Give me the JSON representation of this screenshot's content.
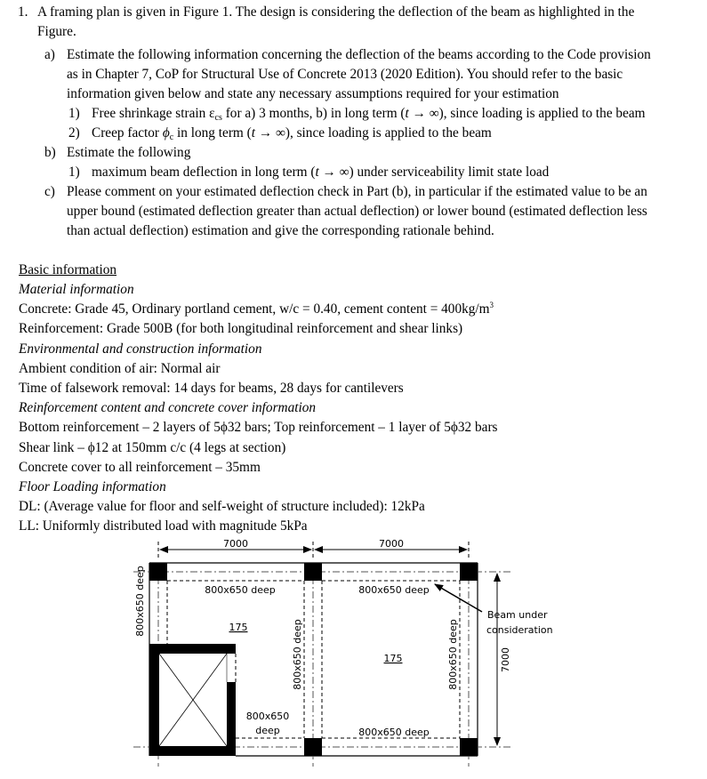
{
  "question": {
    "number": "1.",
    "intro_line1": "A framing plan is given in Figure 1. The design is considering the deflection of the beam as highlighted in the",
    "intro_line2": "Figure.",
    "part_a": {
      "label": "a)",
      "line1": "Estimate the following information concerning the deflection of the beams according to the Code provision",
      "line2": "as in Chapter 7, CoP for Structural Use of Concrete 2013 (2020 Edition). You should refer to the basic",
      "line3": "information given below and state any necessary assumptions required for your estimation",
      "items": [
        {
          "num": "1)",
          "pre": "Free shrinkage strain ",
          "sym": "ε",
          "sub": "cs",
          "post": " for a) 3 months, b) in long term (",
          "t": "t",
          "arrow": " → ∞), since loading is applied to the beam"
        },
        {
          "num": "2)",
          "pre": "Creep factor ",
          "sym": "ϕ",
          "sub": "c",
          "post": " in long term (",
          "t": "t",
          "arrow": " → ∞), since loading is applied to the beam"
        }
      ]
    },
    "part_b": {
      "label": "b)",
      "line1": "Estimate the following",
      "items": [
        {
          "num": "1)",
          "pre": "maximum beam deflection in long term (",
          "t": "t",
          "post": " → ∞) under serviceability limit state load"
        }
      ]
    },
    "part_c": {
      "label": "c)",
      "line1": "Please comment on your estimated deflection check in Part (b), in particular if the estimated value to be an",
      "line2": "upper bound (estimated deflection greater than actual deflection) or lower bound (estimated deflection less",
      "line3": "than actual deflection) estimation and give the corresponding rationale behind."
    }
  },
  "basic_info": {
    "heading": "Basic information",
    "material_heading": "Material information",
    "concrete": "Concrete: Grade 45, Ordinary portland cement, w/c = 0.40, cement content = 400kg/m",
    "concrete_sup": "3",
    "reinforcement": "Reinforcement: Grade 500B (for both longitudinal reinforcement and shear links)",
    "env_heading": "Environmental and construction information",
    "ambient": "Ambient condition of air: Normal air",
    "falsework": "Time of falsework removal: 14 days for beams, 28 days for cantilevers",
    "reinf_heading": "Reinforcement content and concrete cover information",
    "bottom_top": "Bottom reinforcement – 2 layers of 5ϕ32 bars; Top reinforcement – 1 layer of 5ϕ32 bars",
    "shear_link": "Shear link – ϕ12 at 150mm c/c (4 legs at section)",
    "cover": "Concrete cover to all reinforcement – 35mm",
    "loading_heading": "Floor Loading information",
    "dl": "DL: (Average value for floor and self-weight of structure included): 12kPa",
    "ll": "LL: Uniformly distributed load with magnitude 5kPa"
  },
  "figure": {
    "span_left": "7000",
    "span_right": "7000",
    "span_vertical": "7000",
    "beam_top_left": "800x650 deep",
    "beam_top_right": "800x650 deep",
    "beam_left_vertical": "800x650 deep",
    "beam_mid_vertical": "800x650 deep",
    "beam_right_vertical": "800x650 deep",
    "beam_bottom_left_1": "800x650",
    "beam_bottom_left_2": "deep",
    "beam_bottom_right": "800x650 deep",
    "slab_left": "175",
    "slab_right": "175",
    "annotation_1": "Beam under",
    "annotation_2": "consideration"
  }
}
